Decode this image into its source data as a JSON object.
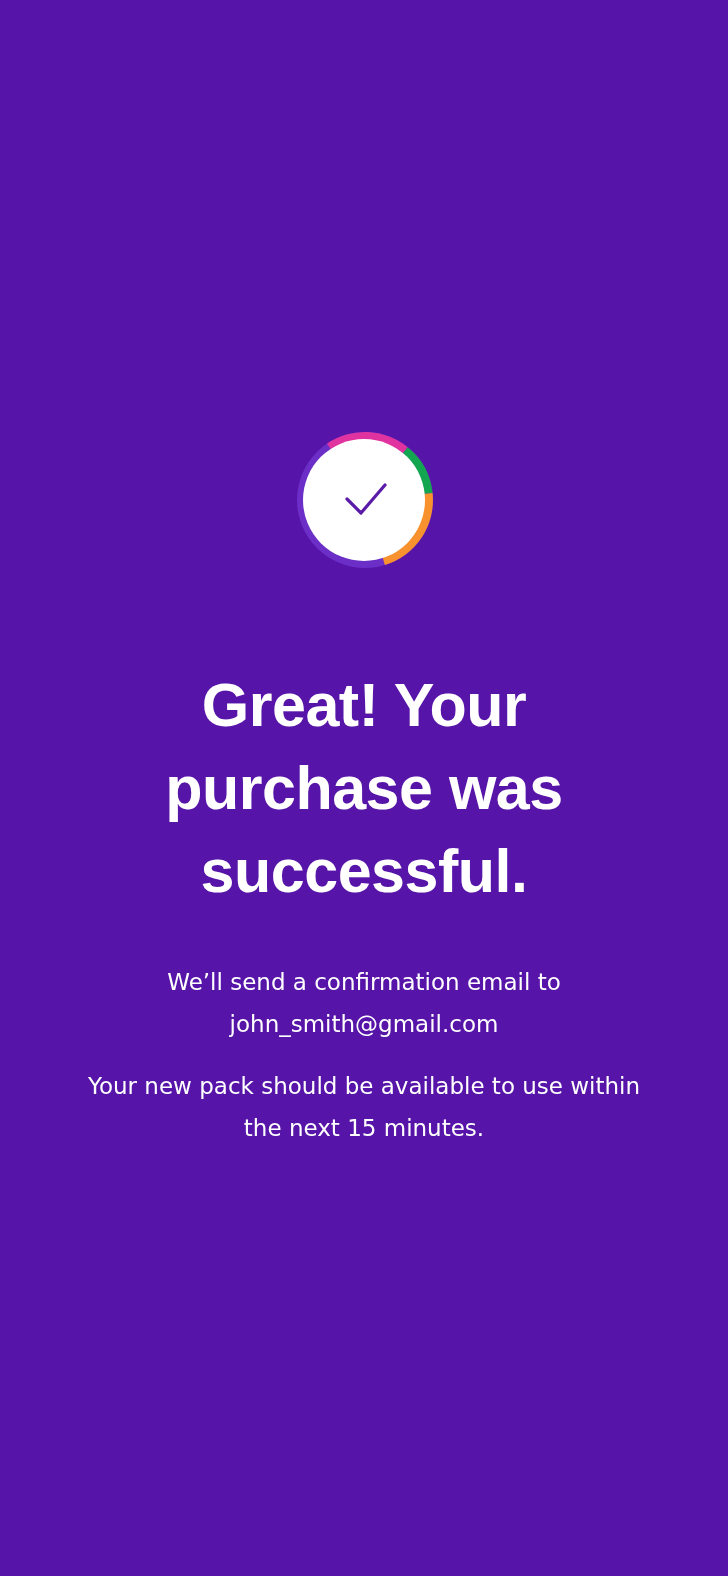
{
  "heading": "Great! Your purchase was successful.",
  "messages": [
    "We’ll send a confirmation email to john_smith@gmail.com",
    "Your new pack should be available to use within the next 15 minutes."
  ]
}
